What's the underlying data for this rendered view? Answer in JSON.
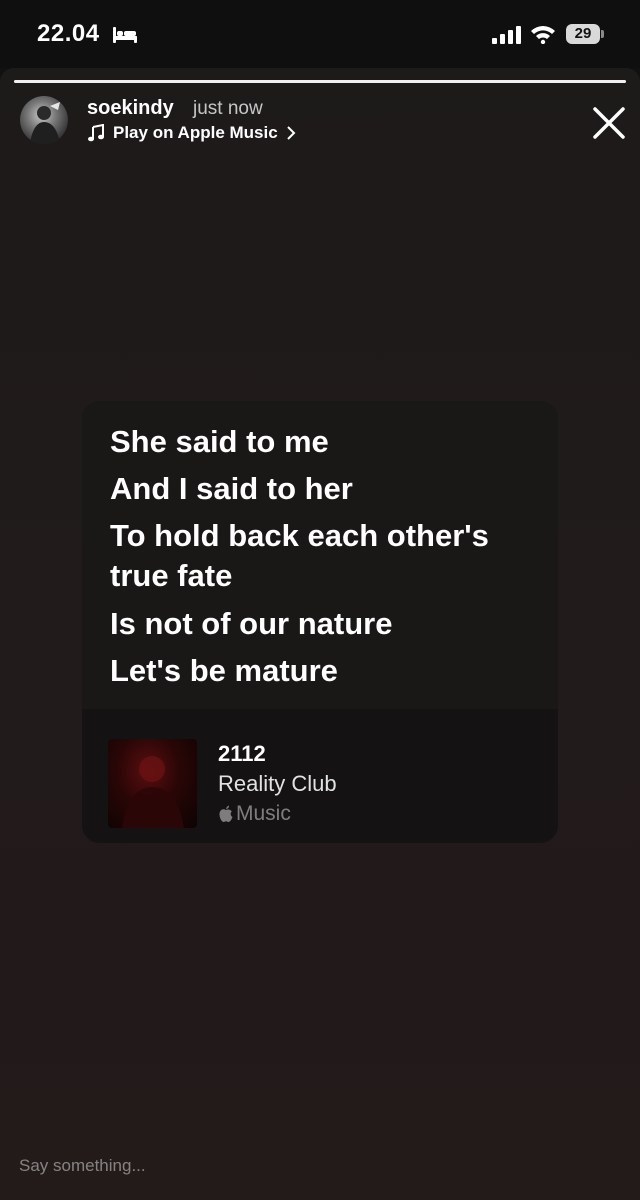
{
  "status_bar": {
    "time": "22.04",
    "battery": "29",
    "icons": [
      "bed-icon",
      "cellular-signal-icon",
      "wifi-icon",
      "battery-icon"
    ]
  },
  "story": {
    "progress": 1.0,
    "username": "soekindy",
    "timestamp": "just now",
    "music_link": "Play on Apple Music",
    "icons": [
      "avatar",
      "music-note-icon",
      "chevron-right-icon",
      "close-icon"
    ]
  },
  "lyrics_card": {
    "lines": [
      "She said to me",
      "And I said to her",
      "To hold back each other's",
      "true fate",
      "Is not of our nature",
      "Let's be mature"
    ],
    "track_title": "2112",
    "artist": "Reality Club",
    "service": "Music",
    "icons": [
      "album-artwork",
      "apple-logo-icon"
    ]
  },
  "reply": {
    "placeholder": "Say something..."
  },
  "colors": {
    "background": "#111111",
    "story_background": "#211b1b",
    "card_background": "#1a1717",
    "artwork_red": "#5a0e10"
  }
}
